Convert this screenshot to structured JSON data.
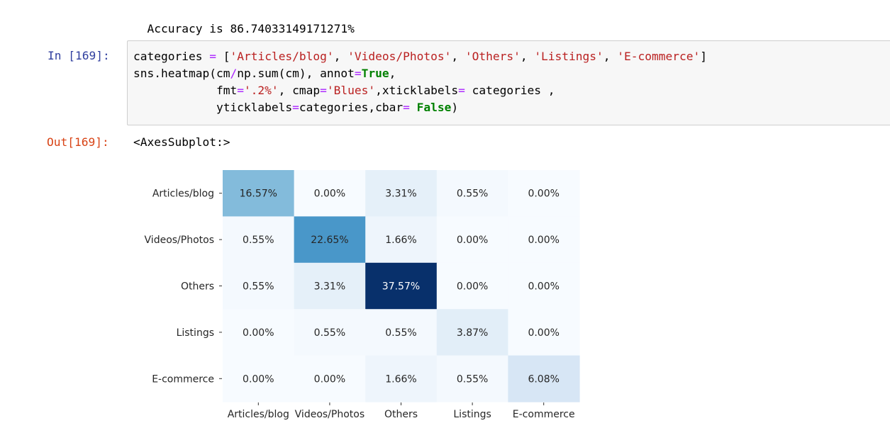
{
  "stdout": {
    "accuracy_line": "Accuracy is 86.74033149171271%"
  },
  "cell_in": {
    "prompt": "In [169]:",
    "code": {
      "l1_var": "categories",
      "l1_eq": " = ",
      "l1_open": "[",
      "l1_s1": "'Articles/blog'",
      "l1_s2": "'Videos/Photos'",
      "l1_s3": "'Others'",
      "l1_s4": "'Listings'",
      "l1_s5": "'E-commerce'",
      "l1_close": "]",
      "sep": ", ",
      "l2_a": "sns.heatmap(cm",
      "l2_div": "/",
      "l2_b": "np.sum(cm), annot",
      "l2_eq": "=",
      "l2_true": "True",
      "l2_c": ",",
      "l3_a": "            fmt",
      "l3_eq": "=",
      "l3_fmt": "'.2%'",
      "l3_b": ", cmap",
      "l3_eq2": "=",
      "l3_cmap": "'Blues'",
      "l3_c": ",xticklabels",
      "l3_eq3": "=",
      "l3_d": " categories ,",
      "l4_a": "            yticklabels",
      "l4_eq": "=",
      "l4_b": "categories,cbar",
      "l4_eq2": "=",
      "l4_sp": " ",
      "l4_false": "False",
      "l4_close": ")"
    }
  },
  "cell_out": {
    "prompt": "Out[169]:",
    "text": "<AxesSubplot:>"
  },
  "chart_data": {
    "type": "heatmap",
    "colormap": "Blues",
    "colorbar": false,
    "row_labels": [
      "Articles/blog",
      "Videos/Photos",
      "Others",
      "Listings",
      "E-commerce"
    ],
    "col_labels": [
      "Articles/blog",
      "Videos/Photos",
      "Others",
      "Listings",
      "E-commerce"
    ],
    "values": [
      [
        16.57,
        0.0,
        3.31,
        0.55,
        0.0
      ],
      [
        0.55,
        22.65,
        1.66,
        0.0,
        0.0
      ],
      [
        0.55,
        3.31,
        37.57,
        0.0,
        0.0
      ],
      [
        0.0,
        0.55,
        0.55,
        3.87,
        0.0
      ],
      [
        0.0,
        0.0,
        1.66,
        0.55,
        6.08
      ]
    ],
    "annotations": [
      [
        "16.57%",
        "0.00%",
        "3.31%",
        "0.55%",
        "0.00%"
      ],
      [
        "0.55%",
        "22.65%",
        "1.66%",
        "0.00%",
        "0.00%"
      ],
      [
        "0.55%",
        "3.31%",
        "37.57%",
        "0.00%",
        "0.00%"
      ],
      [
        "0.00%",
        "0.55%",
        "0.55%",
        "3.87%",
        "0.00%"
      ],
      [
        "0.00%",
        "0.00%",
        "1.66%",
        "0.55%",
        "6.08%"
      ]
    ],
    "value_range": [
      0,
      37.57
    ],
    "colors": {
      "low": "#f7fbff",
      "high": "#08306b",
      "text_dark": "#262626",
      "text_light": "#ffffff"
    }
  }
}
